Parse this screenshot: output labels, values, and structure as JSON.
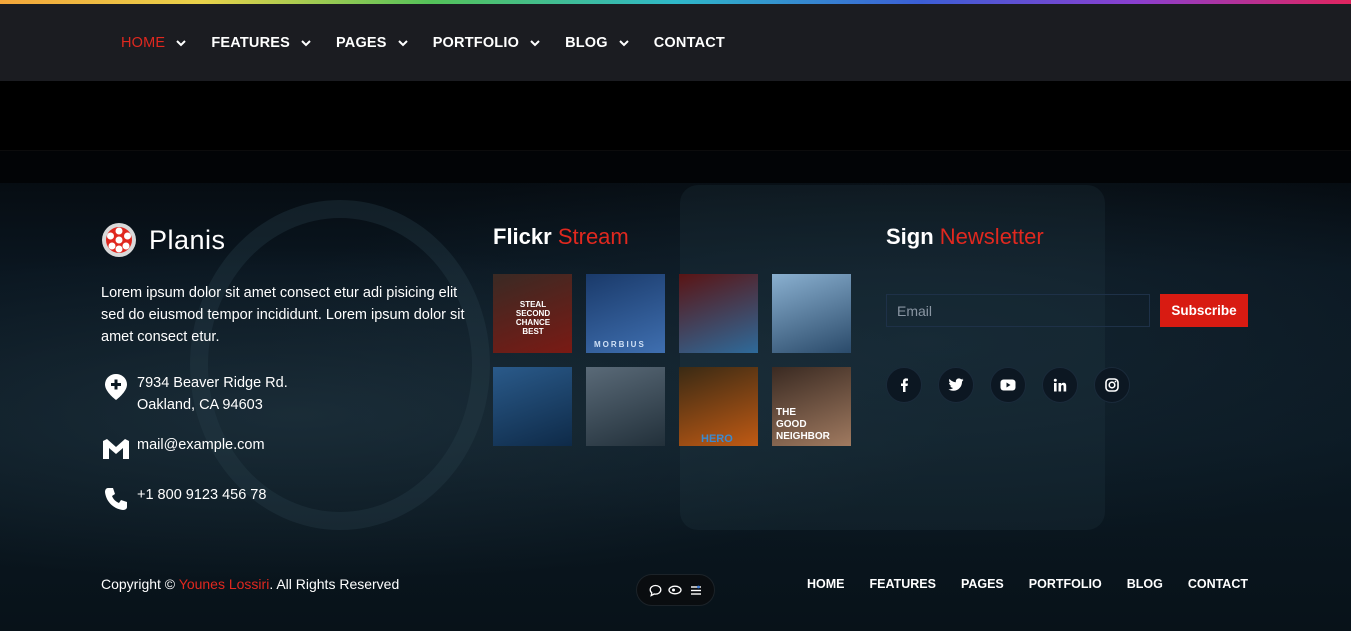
{
  "nav": {
    "items": [
      {
        "label": "HOME",
        "has_dropdown": true,
        "active": true
      },
      {
        "label": "FEATURES",
        "has_dropdown": true
      },
      {
        "label": "PAGES",
        "has_dropdown": true
      },
      {
        "label": "PORTFOLIO",
        "has_dropdown": true
      },
      {
        "label": "BLOG",
        "has_dropdown": true
      },
      {
        "label": "CONTACT",
        "has_dropdown": false
      }
    ]
  },
  "footer": {
    "brand": {
      "name": "Planis",
      "icon": "film-reel-icon"
    },
    "about": "Lorem ipsum dolor sit amet consect etur adi pisicing elit sed do eiusmod tempor incididunt. Lorem ipsum dolor sit amet consect etur.",
    "address_line1": "7934 Beaver Ridge Rd.",
    "address_line2": "Oakland, CA 94603",
    "email": "mail@example.com",
    "phone": "+1 800 9123 456 78",
    "flickr": {
      "title_main": "Flickr",
      "title_accent": "Stream",
      "photos": [
        {
          "caption": "STEAL SECOND CHANCE BEST",
          "colors": [
            "#3a2a24",
            "#7a1a14"
          ]
        },
        {
          "caption": "MORBIUS",
          "colors": [
            "#1a3a6a",
            "#3f6fb0"
          ]
        },
        {
          "caption": "",
          "colors": [
            "#5a1414",
            "#2e6a9a"
          ]
        },
        {
          "caption": "",
          "colors": [
            "#8ab0d0",
            "#2a4a6a"
          ]
        },
        {
          "caption": "",
          "colors": [
            "#2a5a8a",
            "#0e2a48"
          ]
        },
        {
          "caption": "",
          "colors": [
            "#5a6a78",
            "#22303a"
          ]
        },
        {
          "caption": "HERO",
          "colors": [
            "#3a2a14",
            "#c05a14"
          ]
        },
        {
          "caption": "THE GOOD NEIGHBOR",
          "colors": [
            "#3a2a22",
            "#a07a60"
          ]
        }
      ]
    },
    "newsletter": {
      "title_main": "Sign",
      "title_accent": "Newsletter",
      "email_placeholder": "Email",
      "subscribe_label": "Subscribe"
    },
    "socials": [
      "facebook-icon",
      "twitter-icon",
      "youtube-icon",
      "linkedin-icon",
      "instagram-icon"
    ],
    "copyright_prefix": "Copyright ©",
    "copyright_author": "Younes Lossiri",
    "copyright_suffix": ". All Rights Reserved",
    "bottom_nav": [
      "HOME",
      "FEATURES",
      "PAGES",
      "PORTFOLIO",
      "BLOG",
      "CONTACT"
    ]
  },
  "colors": {
    "accent": "#e0281f",
    "nav_bg": "#1b1c21"
  }
}
